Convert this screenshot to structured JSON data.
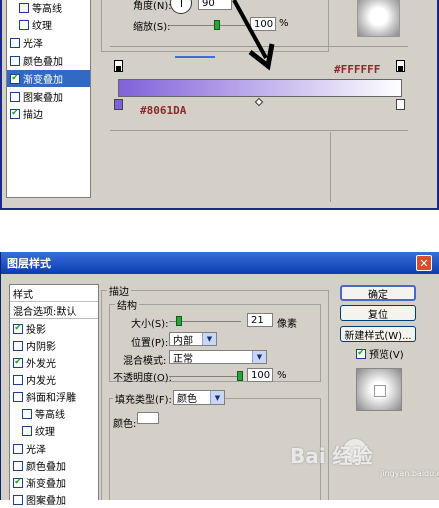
{
  "top_panel": {
    "style_list": [
      {
        "label": "等高线",
        "checked": false,
        "indent": true
      },
      {
        "label": "纹理",
        "checked": false,
        "indent": true
      },
      {
        "label": "光泽",
        "checked": false,
        "indent": false
      },
      {
        "label": "颜色叠加",
        "checked": false,
        "indent": false
      },
      {
        "label": "渐变叠加",
        "checked": true,
        "indent": false,
        "selected": true
      },
      {
        "label": "图案叠加",
        "checked": false,
        "indent": false
      },
      {
        "label": "描边",
        "checked": true,
        "indent": false
      }
    ],
    "angle_label": "角度(N):",
    "angle_value": "90",
    "scale_label": "缩放(S):",
    "scale_value": "100",
    "scale_unit": "%",
    "scale_level_percent": 100,
    "gradient": {
      "start_color": "#8061DA",
      "end_color": "#FFFFFF",
      "start_label": "#8061DA",
      "end_label": "#FFFFFF"
    }
  },
  "dialog": {
    "title": "图层样式",
    "close_glyph": "✕",
    "list_header": "样式",
    "style_list": [
      {
        "label": "混合选项:默认",
        "checked": null
      },
      {
        "label": "投影",
        "checked": true
      },
      {
        "label": "内阴影",
        "checked": false
      },
      {
        "label": "外发光",
        "checked": true
      },
      {
        "label": "内发光",
        "checked": false
      },
      {
        "label": "斜面和浮雕",
        "checked": false
      },
      {
        "label": "等高线",
        "checked": false,
        "indent": true
      },
      {
        "label": "纹理",
        "checked": false,
        "indent": true
      },
      {
        "label": "光泽",
        "checked": false
      },
      {
        "label": "颜色叠加",
        "checked": false
      },
      {
        "label": "渐变叠加",
        "checked": true
      },
      {
        "label": "图案叠加",
        "checked": false
      }
    ],
    "stroke_title": "描边",
    "structure_title": "结构",
    "size_label": "大小(S):",
    "size_value": "21",
    "size_unit": "像素",
    "position_label": "位置(P):",
    "position_value": "内部",
    "blend_label": "混合模式:",
    "blend_value": "正常",
    "opacity_label": "不透明度(O):",
    "opacity_value": "100",
    "opacity_unit": "%",
    "fill_type_label": "填充类型(F):",
    "fill_type_value": "颜色",
    "color_label": "颜色:",
    "buttons": {
      "ok": "确定",
      "reset": "复位",
      "new_style": "新建样式(W)..."
    },
    "preview_label": "预览(V)",
    "preview_checked": true
  },
  "watermark": {
    "text": "Bai 经验",
    "sub": "jingyan.baidu.com"
  },
  "colors": {
    "title_bar": "#0a3cb0",
    "selection": "#316ac5",
    "panel_bg": "#d4d0c8"
  }
}
